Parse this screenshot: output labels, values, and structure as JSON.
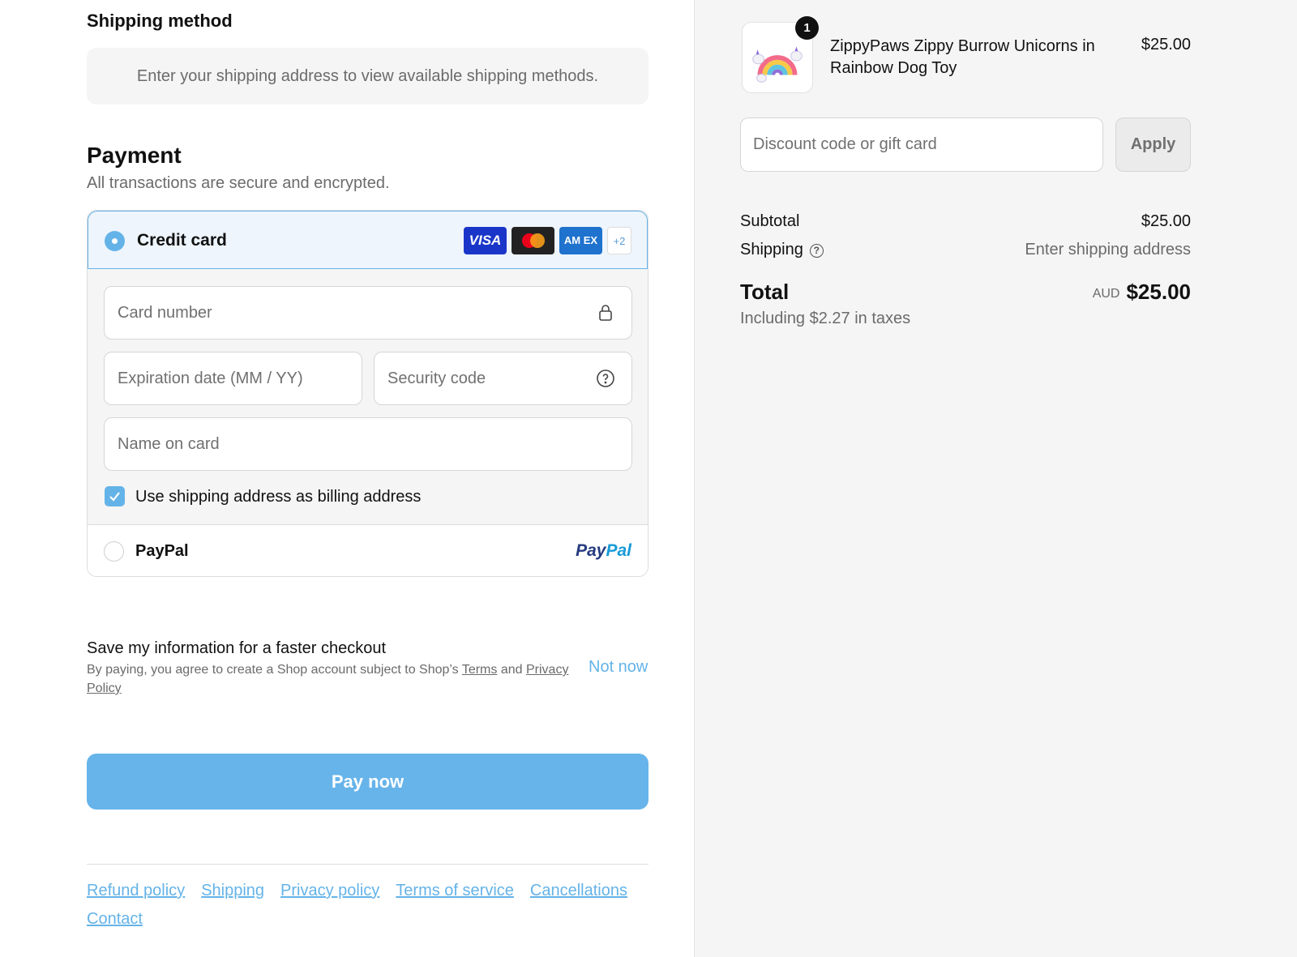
{
  "shipping": {
    "heading": "Shipping method",
    "notice": "Enter your shipping address to view available shipping methods."
  },
  "payment": {
    "heading": "Payment",
    "subtext": "All transactions are secure and encrypted.",
    "credit_card": {
      "label": "Credit card",
      "brands": [
        "VISA",
        "AM EX",
        "+2"
      ],
      "card_number_placeholder": "Card number",
      "expiration_placeholder": "Expiration date (MM / YY)",
      "security_placeholder": "Security code",
      "name_placeholder": "Name on card",
      "billing_checkbox_label": "Use shipping address as billing address"
    },
    "paypal": {
      "label": "PayPal",
      "logo_a": "Pay",
      "logo_b": "Pal"
    }
  },
  "save_info": {
    "title": "Save my information for a faster checkout",
    "note_prefix": "By paying, you agree to create a Shop account subject to Shop’s ",
    "terms_link": "Terms",
    "note_mid": " and ",
    "privacy_link": "Privacy Policy",
    "not_now": "Not now"
  },
  "pay_button": "Pay now",
  "footer_links": [
    "Refund policy",
    "Shipping",
    "Privacy policy",
    "Terms of service",
    "Cancellations",
    "Contact"
  ],
  "order": {
    "quantity": "1",
    "product_name": "ZippyPaws Zippy Burrow Unicorns in Rainbow Dog Toy",
    "product_price": "$25.00",
    "discount_placeholder": "Discount code or gift card",
    "apply_label": "Apply",
    "subtotal_label": "Subtotal",
    "subtotal_value": "$25.00",
    "shipping_label": "Shipping",
    "shipping_value": "Enter shipping address",
    "total_label": "Total",
    "currency": "AUD",
    "total_value": "$25.00",
    "tax_note": "Including $2.27 in taxes"
  },
  "colors": {
    "accent": "#64b3e8",
    "pay_button": "#66b4ea"
  }
}
